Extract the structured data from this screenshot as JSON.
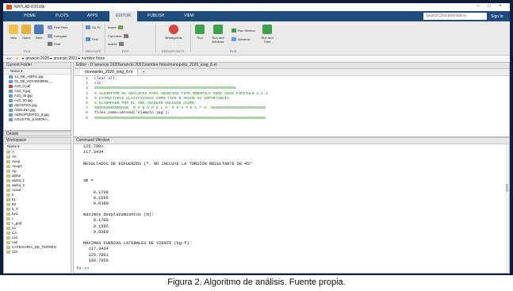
{
  "window": {
    "title": "MATLAB R2018b"
  },
  "tabs": [
    "HOME",
    "PLOTS",
    "APPS",
    "EDITOR",
    "PUBLISH",
    "VIEW"
  ],
  "search": {
    "placeholder": "Search Documentation"
  },
  "signin": "Sign In",
  "ribbon": {
    "new": "New",
    "open": "Open",
    "save": "Save",
    "find_files": "Find Files",
    "compare": "Compare",
    "print": "Print",
    "go_to": "Go To",
    "find": "Find",
    "insert": "Insert",
    "comment": "Comment",
    "indent": "Indent",
    "breakpoints": "Breakpoints",
    "run": "Run",
    "run_advance": "Run and Advance",
    "run_section": "Run Section",
    "advance": "Advance",
    "run_time": "Run and Time",
    "groups": [
      "FILE",
      "NAVIGATE",
      "EDIT",
      "BREAKPOINTS",
      "RUN"
    ]
  },
  "path": "▸ anuncio 2020 ▸ anuncio 2021 ▸ nombre fotos",
  "current_folder": {
    "title": "Current Folder",
    "header": "Name ▾",
    "files": [
      "14_DE_ABRIL.jpg",
      "25_DE_NOVIEMBRE_...",
      "A10_0.pdf",
      "A10_0.jpg",
      "A10_45.jpg",
      "A10_90.jpg",
      "ABASTOS.jpg",
      "ADELINA.jpg",
      "AEROPUERTO_8.jpg",
      "AGUSTIN_ZAMORA..."
    ]
  },
  "details": "Details",
  "workspace": {
    "title": "Workspace",
    "header": "Name ▾",
    "vars": [
      "A",
      "A0",
      "Aexp",
      "Aexp1",
      "Ag",
      "alpha",
      "alpha_1",
      "alpha_2",
      "Aoisé",
      "b",
      "b1",
      "B2",
      "b_T",
      "bv4",
      "c",
      "c_graf",
      "ca",
      "CA",
      "ca1",
      "ca2",
      "CATEGORIA_DE_TERREN",
      "CM"
    ]
  },
  "editor": {
    "title": "Editor - D:\\anuncio 2020\\anuncio 2021\\nombre fotos\\monopolio_2020_long_8.m",
    "tab": "monopolio_2020_long_8.m",
    "lines": [
      {
        "n": "1",
        "t": "clear all;",
        "c": "#1a1a8f"
      },
      {
        "n": "2",
        "t": "clc;",
        "c": "#1a1a8f"
      },
      {
        "n": "3",
        "t": "%%%%%%%%%%%%%%%%%%%%%%%%%%%%%%%%%%%%%%%%%%%%%%%%%%%%%%%%%%%%%%",
        "c": "#228b22"
      },
      {
        "n": "4",
        "t": "% ALGORITMO DE ANÁLISIS PARA ANUNCIOS TIPO MONOPOLO MDOC-2020 CAPÍTULO C.1.4",
        "c": "#228b22"
      },
      {
        "n": "5",
        "t": "% ESTRUCTURAS CLASIFICADAS COMO TIPO B SEGÚN SU IMPORTANCIA",
        "c": "#228b22"
      },
      {
        "n": "6",
        "t": "% ELABORADO POR EL ING.JOAQUÍN HOLGUÍN ACUÑA",
        "c": "#228b22"
      },
      {
        "n": "7",
        "t": "%%%%%%%%%%%%%%%  M O N O P O L O  P R O Y E C T O  %%%%%%%%%%%%%%%%%%%%%%%%",
        "c": "#228b22"
      },
      {
        "n": "8",
        "t": "files_name=imread('ejemplo.jpg');",
        "c": "#111111"
      },
      {
        "n": "9",
        "t": "%%%%%%%%%%%%%%%%%%%%%%%%%%%%%%%%%%%%%%%%%%%%%%%%%%%%%%%%%%%%%%%%%%%%%%%%%%%",
        "c": "#228b22"
      }
    ]
  },
  "command_window": {
    "title": "Command Window",
    "lines": [
      "125.7901",
      "117.3434",
      "",
      "RESULTADOS DE ESFUERZOS (º. NO INCLUYE LA TORSIÓN RESULTANTE DE 45°",
      "",
      "",
      "sm =",
      "",
      "    0.1700",
      "    0.1595",
      "    0.0389",
      "",
      "máximos desplazamientos (m):",
      "    0.1700",
      "    0.1595",
      "    0.0389",
      "",
      "MÁXIMAS FUERZAS LATERALES DE VIENTO (kg-f):",
      "  117.3434",
      "  125.7901",
      "  330.7956"
    ],
    "prompt": "fx >>"
  },
  "caption": "Figura 2. Algoritmo de análisis. Fuente propia."
}
